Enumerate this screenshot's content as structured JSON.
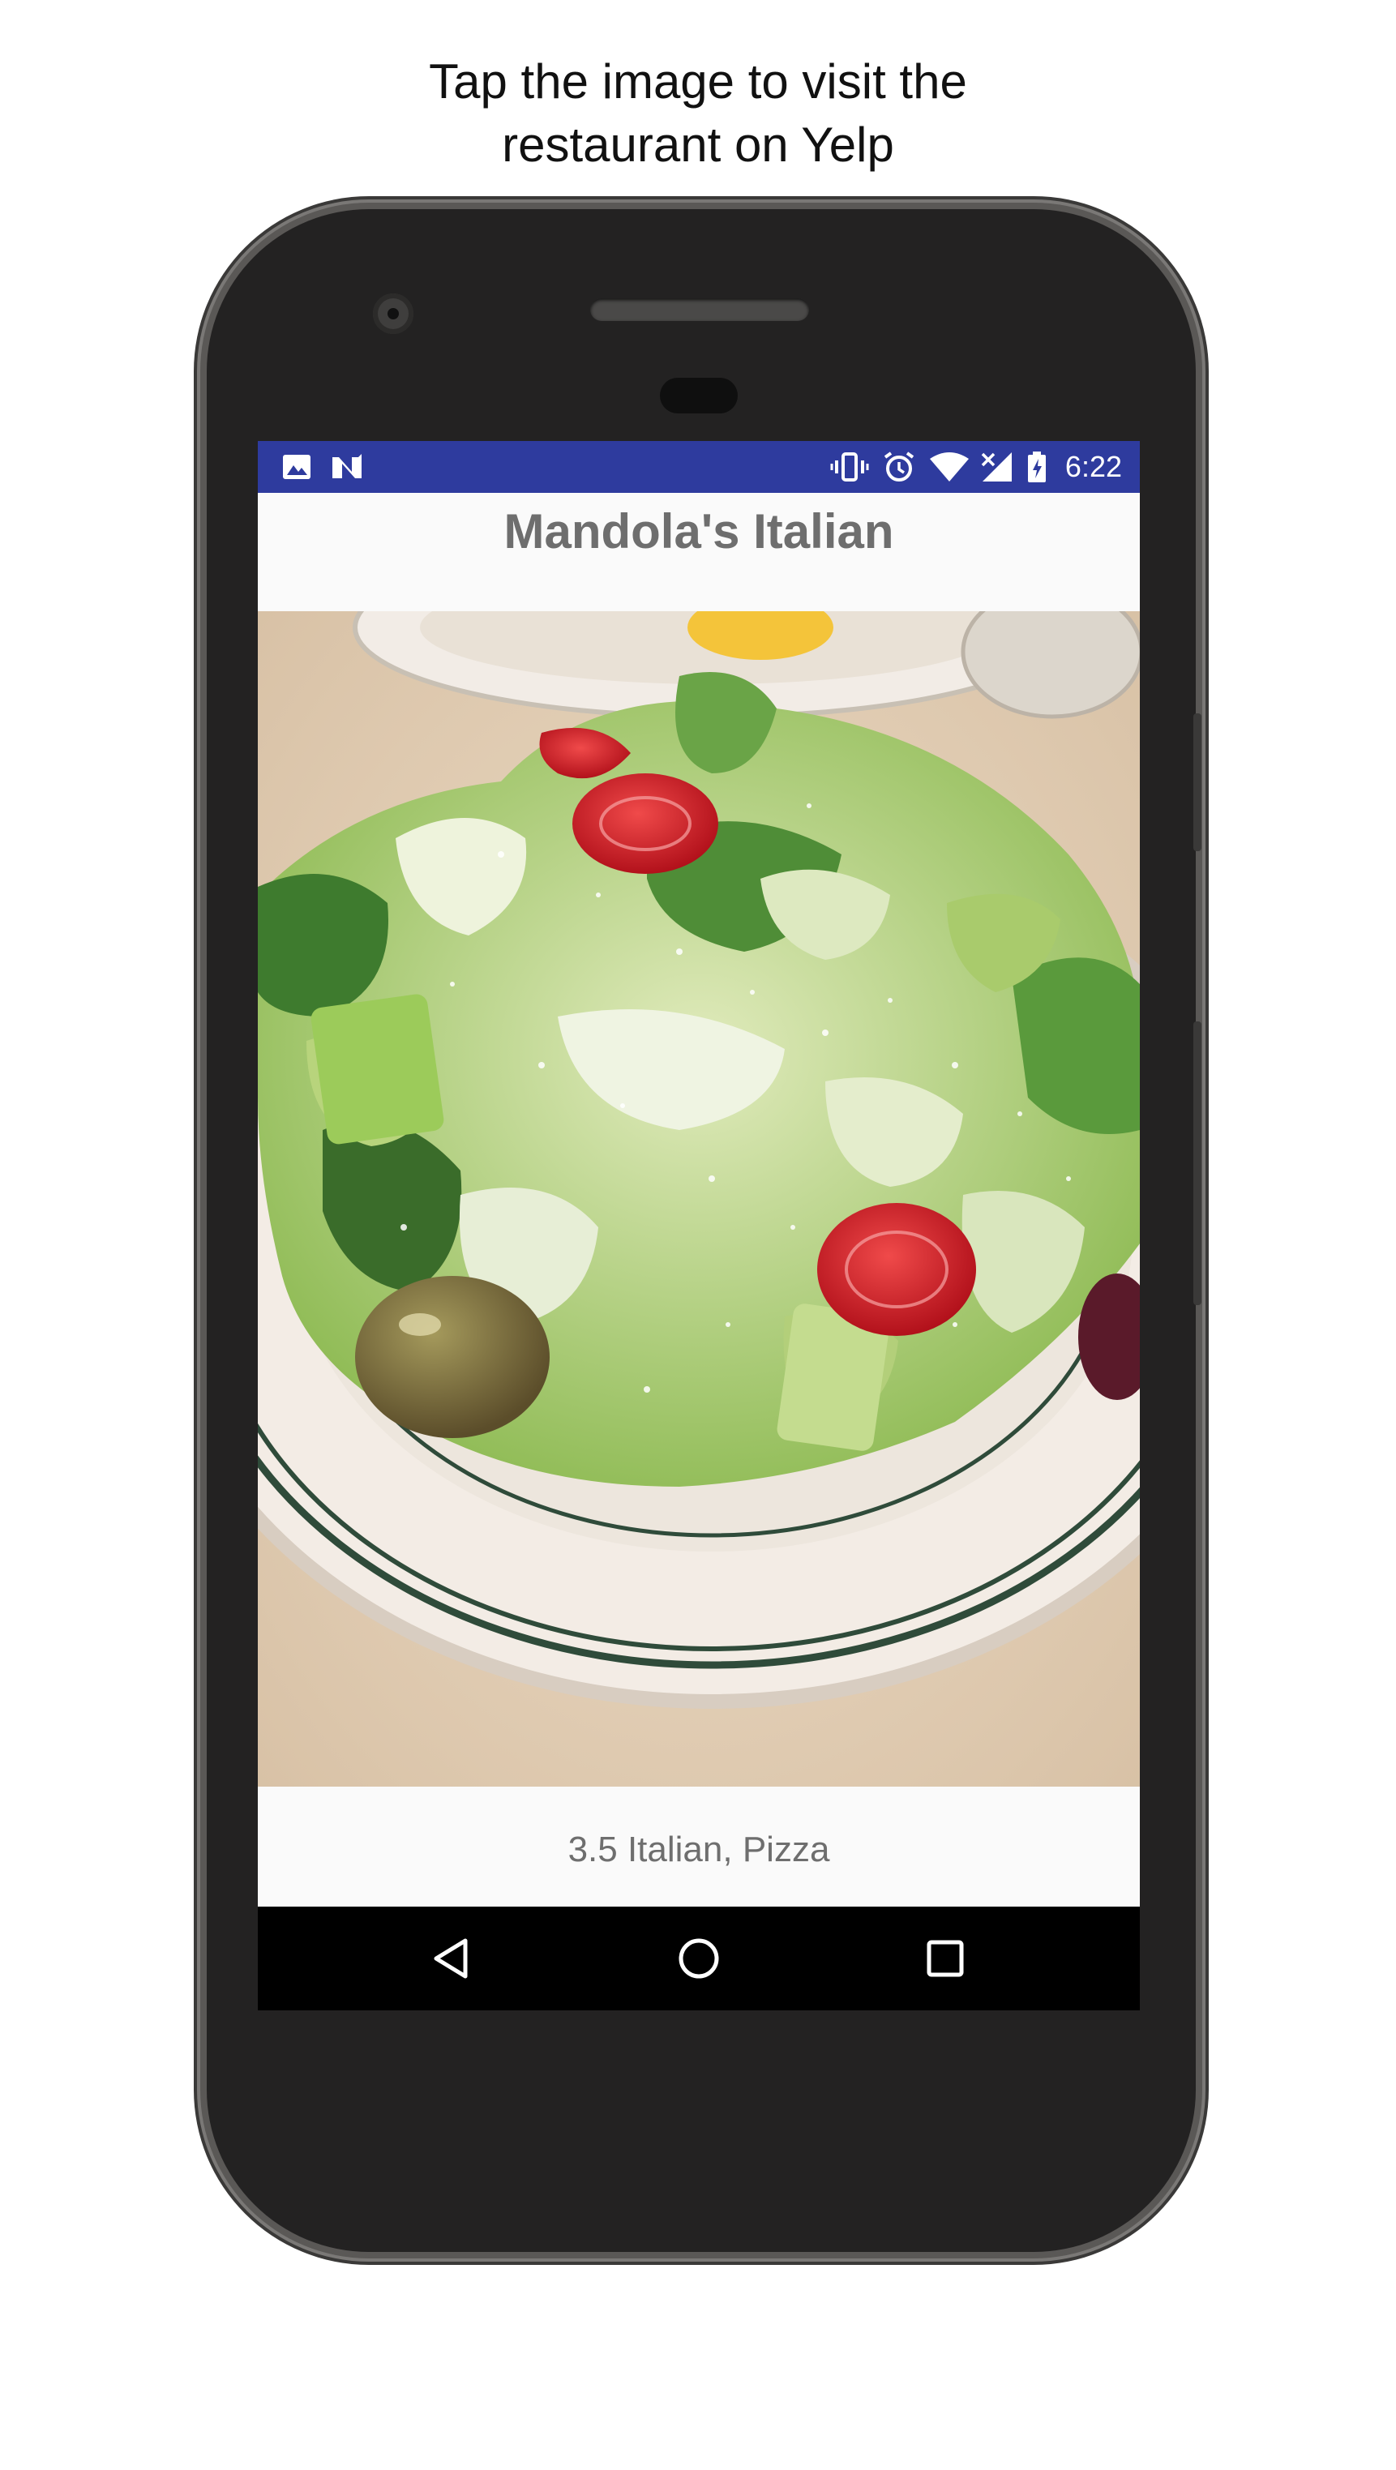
{
  "caption": {
    "line1": "Tap the image to visit the",
    "line2": "restaurant on Yelp"
  },
  "status_bar": {
    "time": "6:22",
    "left_icons": [
      "image-icon",
      "n-notification-icon"
    ],
    "right_icons": [
      "vibrate-icon",
      "alarm-icon",
      "wifi-icon",
      "cellular-signal-icon",
      "battery-charging-icon"
    ],
    "color": "#2e3b9e"
  },
  "restaurant": {
    "name": "Mandola's Italian",
    "photo_alt": "Salad",
    "rating_categories": "3.5 Italian, Pizza"
  },
  "nav_bar": {
    "buttons": [
      "back-icon",
      "home-icon",
      "recents-icon"
    ]
  }
}
